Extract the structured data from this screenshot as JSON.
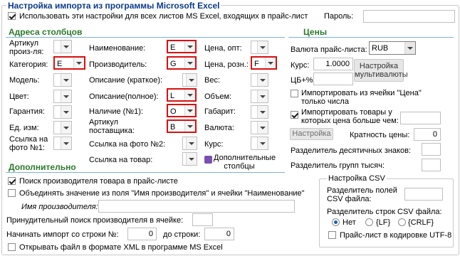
{
  "title": "Настройка импорта из программы Microsoft Excel",
  "use_all_sheets": {
    "label": "Использовать эти настройки для всех листов MS Excel, входящих в прайс-лист",
    "checked": true
  },
  "password_label": "Пароль:",
  "columns": {
    "header": "Адреса столбцов",
    "col1": [
      {
        "label": "Артикул произ-ля:",
        "value": ""
      },
      {
        "label": "Категория:",
        "value": "E",
        "highlight": true
      },
      {
        "label": "Модель:",
        "value": ""
      },
      {
        "label": "Цвет:",
        "value": ""
      },
      {
        "label": "Гарантия:",
        "value": ""
      },
      {
        "label": "Ед. изм:",
        "value": ""
      },
      {
        "label": "Ссылка на фото №1:",
        "value": ""
      }
    ],
    "col2": [
      {
        "label": "Наименование:",
        "value": "E",
        "highlight": true
      },
      {
        "label": "Производитель:",
        "value": "G",
        "highlight": true
      },
      {
        "label": "Описание (краткое):",
        "value": ""
      },
      {
        "label": "Описание(полное):",
        "value": "L",
        "highlight": true
      },
      {
        "label": "Наличие (№1):",
        "value": "O",
        "highlight": true
      },
      {
        "label": "Артикул поставщика:",
        "value": "B",
        "highlight": true
      },
      {
        "label": "Ссылка на фото №2:",
        "value": ""
      },
      {
        "label": "Ссылка на товар:",
        "value": ""
      }
    ],
    "col3": [
      {
        "label": "Цена, опт:",
        "value": ""
      },
      {
        "label": "Цена, розн.:",
        "value": "F",
        "highlight": true
      },
      {
        "label": "Вес:",
        "value": ""
      },
      {
        "label": "Объем:",
        "value": ""
      },
      {
        "label": "Габарит:",
        "value": ""
      },
      {
        "label": "Валюта:",
        "value": ""
      },
      {
        "label": "Курс:",
        "value": ""
      }
    ],
    "extra_columns_label": "Дополнительные столбцы"
  },
  "prices": {
    "header": "Цены",
    "currency_label": "Валюта прайс-листа:",
    "currency_value": "RUB",
    "rate_label": "Курс:",
    "rate_value": "1.0000",
    "cb_label": "ЦБ+%",
    "cb_value": "",
    "multicurrency_button": "Настройка мультивалюты",
    "import_from_price_cell": {
      "label": "Импортировать из ячейки \"Цена\" только числа",
      "checked": false
    },
    "import_above_price": {
      "label": "Импортировать товары у которых цена больше чем:",
      "checked": true,
      "value": ""
    },
    "settings_button": "Настройка",
    "multiplicity_label": "Кратность цены:",
    "multiplicity_value": "0",
    "decimal_separator_label": "Разделитель десятичных знаков:",
    "decimal_separator_value": "",
    "group_separator_label": "Разделитель групп тысяч:",
    "group_separator_value": ""
  },
  "extra": {
    "header": "Дополнительно",
    "find_manufacturer": {
      "label": "Поиск производителя товара в прайс-листе",
      "checked": true
    },
    "merge_name": {
      "label": "Объединять значение из поля \"Имя производителя\" и ячейки \"Наименование\"",
      "checked": false
    },
    "manufacturer_name_label": "Имя производителя:",
    "manufacturer_name_value": "",
    "forced_search_label": "Принудительный поиск производителя в ячейке:",
    "forced_search_value": "",
    "start_row_label": "Начинать импорт со строки №:",
    "start_row_value": "0",
    "end_row_label": "до строки:",
    "end_row_value": "0",
    "open_xml": {
      "label": "Открывать файл в формате XML в программе MS Excel",
      "checked": false
    }
  },
  "csv": {
    "title": "Настройка CSV",
    "field_sep_label": "Разделитель полей CSV файла:",
    "field_sep_value": "",
    "row_sep_label": "Разделитель строк CSV файла:",
    "options": [
      {
        "label": "Нет",
        "selected": true
      },
      {
        "label": "{LF}",
        "selected": false
      },
      {
        "label": "{CRLF}",
        "selected": false
      }
    ],
    "utf8": {
      "label": "Прайс-лист в кодировке UTF-8",
      "checked": false
    }
  }
}
